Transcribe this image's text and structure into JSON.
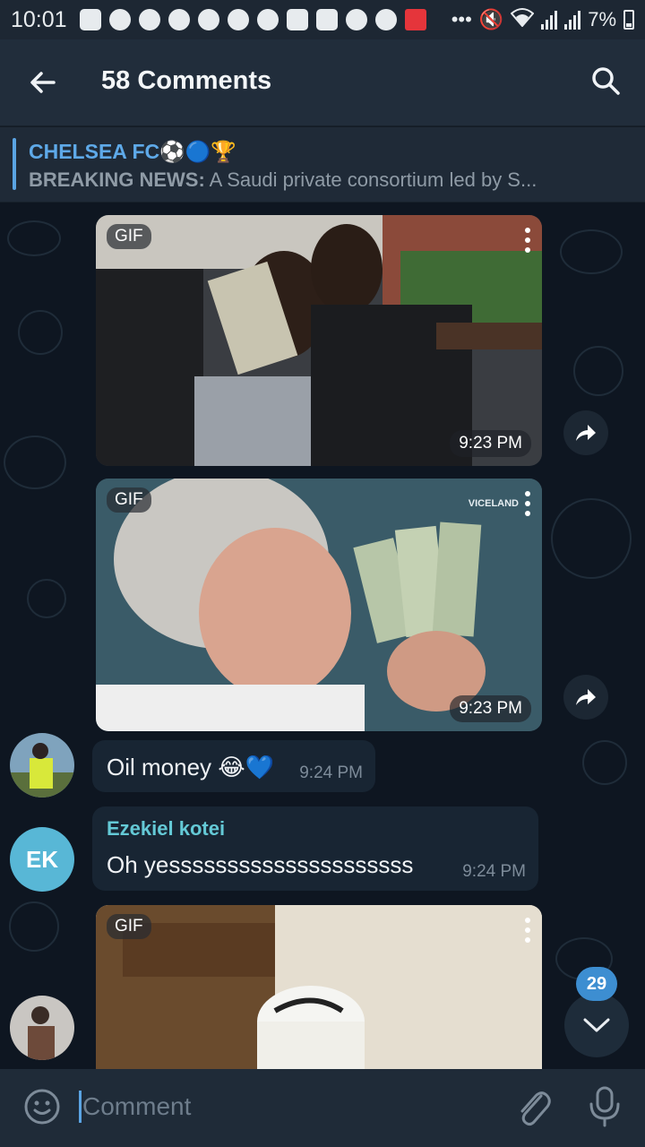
{
  "status_bar": {
    "time": "10:01",
    "battery": "7%",
    "icons": [
      "netflix-icon",
      "facebook-icon",
      "pinterest-icon",
      "manutd-icon",
      "twitter-icon",
      "manutd-icon",
      "premier-league-icon",
      "youtube-icon",
      "youtube-icon",
      "twitter-icon",
      "thumb-icon",
      "kilimall-icon",
      "more-dots-icon"
    ]
  },
  "header": {
    "title": "58 Comments"
  },
  "pinned": {
    "title": "CHELSEA FC⚽🔵🏆",
    "prefix": "BREAKING NEWS:",
    "text": " A Saudi private consortium led by S..."
  },
  "messages": {
    "gif1": {
      "badge": "GIF",
      "time": "9:23 PM"
    },
    "gif2": {
      "badge": "GIF",
      "time": "9:23 PM",
      "watermark": "VICELAND"
    },
    "msg1": {
      "text": "Oil money 😂💙",
      "time": "9:24 PM"
    },
    "msg2": {
      "sender": "Ezekiel kotei",
      "avatar_initials": "EK",
      "text": "Oh yesssssssssssssssssssss",
      "time": "9:24 PM"
    },
    "gif3": {
      "badge": "GIF"
    }
  },
  "scroll": {
    "unread_count": "29"
  },
  "input": {
    "placeholder": "Comment"
  },
  "colors": {
    "accent": "#5aa4e3",
    "sender_name": "#64c9d6",
    "background": "#0e1621"
  }
}
